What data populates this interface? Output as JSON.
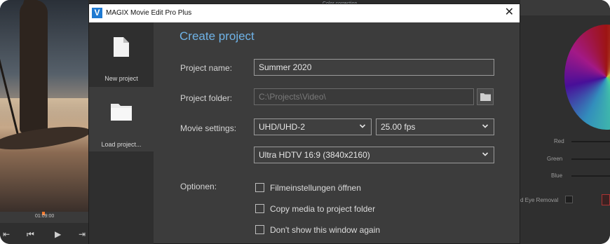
{
  "dialog": {
    "title": "MAGIX Movie Edit Pro Plus",
    "app_icon_letter": "V",
    "heading": "Create project"
  },
  "sidebar": {
    "items": [
      {
        "label": "New project",
        "icon": "new-document-icon",
        "active": false
      },
      {
        "label": "Load project...",
        "icon": "folder-icon",
        "active": true
      }
    ]
  },
  "form": {
    "project_name": {
      "label": "Project name:",
      "value": "Summer 2020"
    },
    "project_folder": {
      "label": "Project folder:",
      "value": "C:\\Projects\\Video\\"
    },
    "movie_settings": {
      "label": "Movie settings:",
      "resolution": "UHD/UHD-2",
      "framerate": "25.00 fps",
      "format": "Ultra HDTV 16:9 (3840x2160)"
    },
    "options": {
      "label": "Optionen:",
      "items": [
        {
          "label": "Filmeinstellungen öffnen",
          "checked": false
        },
        {
          "label": "Copy media to project folder",
          "checked": false
        },
        {
          "label": "Don't show this window again",
          "checked": false
        }
      ]
    }
  },
  "background": {
    "timecode": "01:09:00",
    "color_panel": {
      "title": "Color correction",
      "labels": {
        "red": "Red",
        "green": "Green",
        "blue": "Blue"
      },
      "eye_removal": "d Eye Removal"
    }
  },
  "colors": {
    "accent": "#6fb2e6",
    "dialog_bg": "#3c3c3c",
    "sidebar_bg": "#2f2f2f"
  }
}
